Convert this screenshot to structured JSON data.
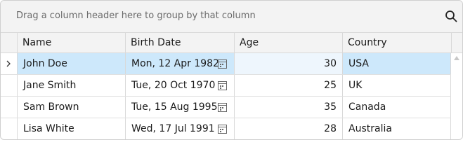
{
  "group_panel": {
    "text": "Drag a column header here to group by that column",
    "search_icon": "search-icon"
  },
  "columns": [
    {
      "key": "name",
      "label": "Name"
    },
    {
      "key": "birth_date",
      "label": "Birth Date"
    },
    {
      "key": "age",
      "label": "Age"
    },
    {
      "key": "country",
      "label": "Country"
    }
  ],
  "rows": [
    {
      "name": "John Doe",
      "birth_date": "Mon, 12 Apr 1982",
      "age": "30",
      "country": "USA",
      "selected": true
    },
    {
      "name": "Jane Smith",
      "birth_date": "Tue, 20 Oct 1970",
      "age": "25",
      "country": "UK",
      "selected": false
    },
    {
      "name": "Sam Brown",
      "birth_date": "Tue, 15 Aug 1995",
      "age": "35",
      "country": "Canada",
      "selected": false
    },
    {
      "name": "Lisa White",
      "birth_date": "Wed, 17 Jul 1991",
      "age": "28",
      "country": "Australia",
      "selected": false
    }
  ],
  "icons": {
    "row_indicator": "chevron-right-icon",
    "date_picker": "calendar-icon",
    "scroll_up": "scroll-up-arrow-icon"
  },
  "colors": {
    "selected_row": "#cde8fb",
    "focused_cell": "#eef6fd",
    "header_bg": "#f3f3f3"
  }
}
